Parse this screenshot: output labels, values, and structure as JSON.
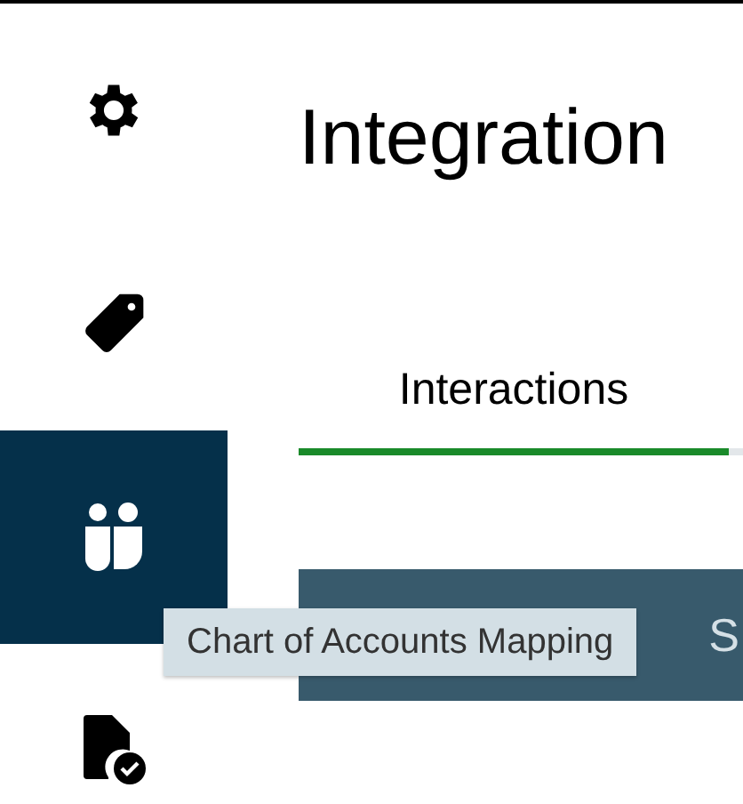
{
  "sidebar": {
    "items": [
      {
        "kind": "gear",
        "selected": false
      },
      {
        "kind": "tag",
        "selected": false
      },
      {
        "kind": "people",
        "selected": true
      },
      {
        "kind": "document",
        "selected": false
      }
    ]
  },
  "page": {
    "title": "Integration"
  },
  "tabs": [
    {
      "label": "Interactions",
      "selected": true
    }
  ],
  "panel": {
    "text": "S"
  },
  "tooltip": {
    "text": "Chart of Accounts Mapping"
  }
}
